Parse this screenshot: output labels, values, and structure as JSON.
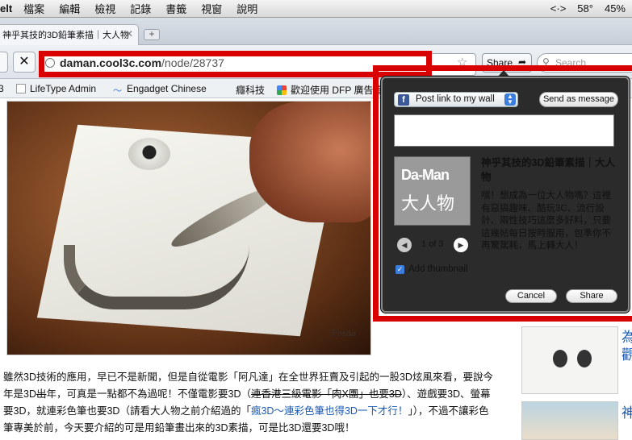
{
  "menubar": {
    "app_name": "elt",
    "items": [
      "檔案",
      "編輯",
      "檢視",
      "記錄",
      "書籤",
      "視窗",
      "說明"
    ],
    "status": {
      "nav_arrows": "<·>",
      "temperature": "58°",
      "battery": "45%"
    }
  },
  "tab": {
    "title": "神乎其技的3D鉛筆素描｜大人物",
    "close": "✕",
    "new_tab": "+"
  },
  "toolbar": {
    "stop_label": "✕",
    "url_domain": "daman.cool3c.com",
    "url_path": "/node/28737",
    "share_label": "Share",
    "search_placeholder": "Search"
  },
  "bookmarks": [
    {
      "label": "",
      "icon": "partial-icon"
    },
    {
      "label": "LifeType Admin",
      "icon": "page-icon"
    },
    {
      "label": "Engadget Chinese",
      "icon": "feed-icon"
    },
    {
      "label": "癮科技",
      "icon": "none"
    },
    {
      "label": "歡迎使用 DFP 廣告管",
      "icon": "google-icon"
    }
  ],
  "photo": {
    "signature": "Fredo"
  },
  "article": {
    "p1": "雖然3D技術的應用，早已不是新聞，但是自從電影「阿凡達」在全世界狂賣及引起的一股3D炫風來看，要說今年是3D",
    "p1_strike": "出",
    "p1b": "年，可真是一點都不為過呢！不僅電影要3D（",
    "p1_strike2": "連香港三級電影「肉X團」也要3D",
    "p1c": "）、遊戲要3D、螢幕要3D，就連彩色筆也要3D（請看大人物之前介紹過的「",
    "link": "瘋3D～連彩色筆也得3D一下才行！",
    "p1d": "」），不過不讓彩色筆專美於前，今天要介紹的可是用鉛筆畫出來的3D素描，可是比3D還要3D哦！"
  },
  "sidebar": {
    "title1": "為",
    "title2": "觀",
    "title3": "神"
  },
  "share_popup": {
    "post_option": "Post link to my wall",
    "send_message": "Send as message",
    "message_value": "",
    "logo_line1": "Da-Man",
    "logo_line2": "大人物",
    "title": "神乎其技的3D鉛筆素描｜大人物",
    "description": "嘿！想成為一位大人物嗎？這裡有惡搞趣味、酷玩3C、流行設計、兩性技巧這麼多好料，只要這幾帖每日按時服用，包準你不再驚駕耗，馬上轉大人！",
    "counter": "1 of 3",
    "add_thumbnail": "Add thumbnail",
    "add_thumbnail_checked": true,
    "cancel": "Cancel",
    "share": "Share"
  },
  "colors": {
    "highlight": "#d80000",
    "popup_bg": "#2b2b2b",
    "link": "#1a5ab4"
  }
}
